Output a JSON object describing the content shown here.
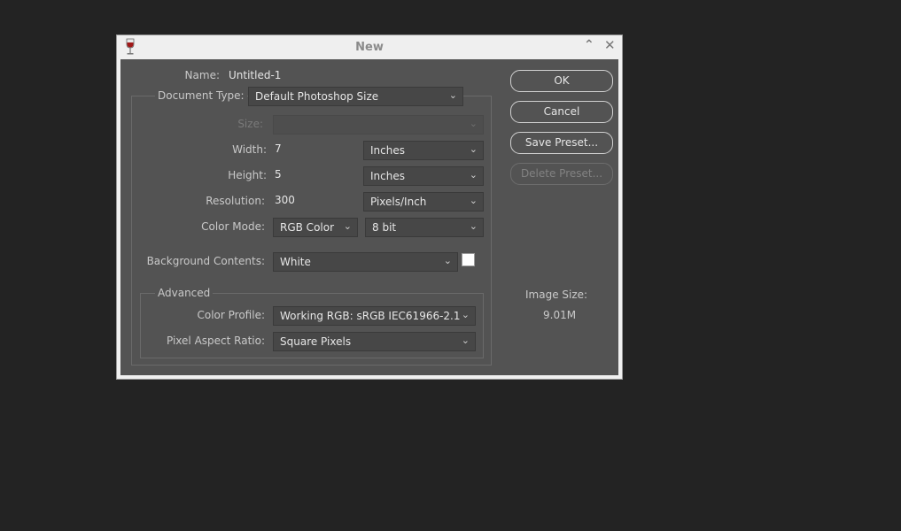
{
  "dialog": {
    "title": "New",
    "name_label": "Name:",
    "name_value": "Untitled-1",
    "document_type_label": "Document Type:",
    "document_type_value": "Default Photoshop Size",
    "size_label": "Size:",
    "size_value": "",
    "width_label": "Width:",
    "width_value": "7",
    "width_unit": "Inches",
    "height_label": "Height:",
    "height_value": "5",
    "height_unit": "Inches",
    "resolution_label": "Resolution:",
    "resolution_value": "300",
    "resolution_unit": "Pixels/Inch",
    "color_mode_label": "Color Mode:",
    "color_mode_value": "RGB Color",
    "bit_depth_value": "8 bit",
    "background_label": "Background Contents:",
    "background_value": "White",
    "advanced_label": "Advanced",
    "color_profile_label": "Color Profile:",
    "color_profile_value": "Working RGB:  sRGB IEC61966-2.1",
    "pixel_aspect_label": "Pixel Aspect Ratio:",
    "pixel_aspect_value": "Square Pixels",
    "image_size_label": "Image Size:",
    "image_size_value": "9.01M"
  },
  "buttons": {
    "ok": "OK",
    "cancel": "Cancel",
    "save_preset": "Save Preset...",
    "delete_preset": "Delete Preset..."
  },
  "icons": {
    "app": "wine-glass-icon",
    "collapse": "chevron-up-icon",
    "close": "close-icon",
    "dropdown": "chevron-down-icon"
  },
  "colors": {
    "background_swatch": "#ffffff"
  }
}
